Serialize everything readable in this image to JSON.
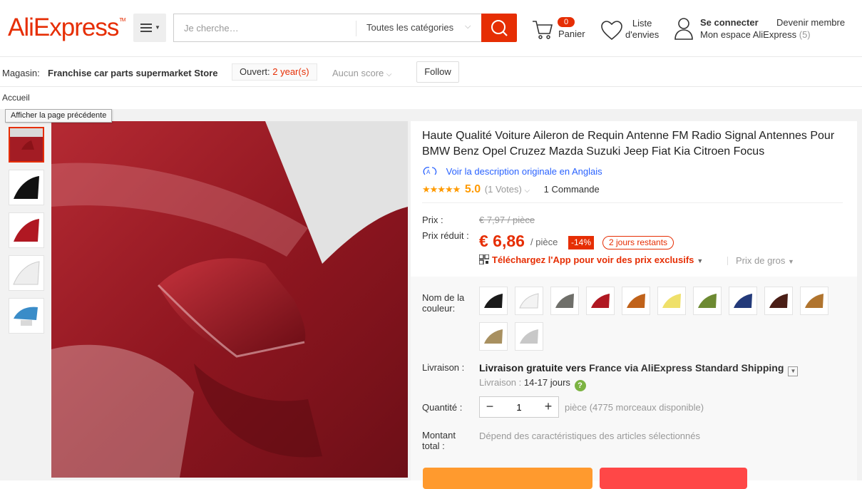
{
  "header": {
    "logo": "AliExpress",
    "logo_tm": "TM",
    "search_placeholder": "Je cherche…",
    "category_select": "Toutes les catégories",
    "cart_count": "0",
    "cart_label": "Panier",
    "wishlist_label_1": "Liste",
    "wishlist_label_2": "d'envies",
    "signin": "Se connecter",
    "join": "Devenir membre",
    "my_account": "Mon espace AliExpress",
    "my_account_count": "(5)"
  },
  "store": {
    "label": "Magasin:",
    "name": "Franchise car parts supermarket Store",
    "open_label": "Ouvert:",
    "open_value": "2 year(s)",
    "score": "Aucun score",
    "follow": "Follow"
  },
  "breadcrumb": "Accueil",
  "tooltip": "Afficher la page précédente",
  "product": {
    "title": "Haute Qualité Voiture Aileron de Requin Antenne FM Radio Signal Antennes Pour BMW Benz Opel Cruzez Mazda Suzuki Jeep Fiat Kia Citroen Focus",
    "translate_link": "Voir la description originale en Anglais",
    "stars": "★★★★★",
    "score": "5.0",
    "votes": "(1 Votes)",
    "orders": "1 Commande",
    "price_label": "Prix :",
    "old_price": "€ 7,97 / pièce",
    "discount_label": "Prix réduit :",
    "price": "€ 6,86",
    "per_unit": "/ pièce",
    "discount": "-14%",
    "remaining": "2 jours restants",
    "app_promo": "Téléchargez l'App pour voir des prix exclusifs",
    "wholesale": "Prix de gros",
    "color_label_1": "Nom de la",
    "color_label_2": "couleur:",
    "delivery_label": "Livraison :",
    "delivery_main": "Livraison gratuite vers",
    "delivery_dest": "France via AliExpress Standard Shipping",
    "delivery_time_label": "Livraison :",
    "delivery_time": "14-17 jours",
    "qty_label": "Quantité :",
    "qty_value": "1",
    "qty_avail": "pièce (4775 morceaux disponible)",
    "total_label_1": "Montant",
    "total_label_2": "total :",
    "total_value": "Dépend des caractéristiques des articles sélectionnés"
  },
  "colors": {
    "brand": "#e62e04",
    "swatches": [
      "#1a1a1a",
      "#f3f3f3",
      "#6f6f6a",
      "#b01822",
      "#c0621a",
      "#efe06a",
      "#6d8a32",
      "#233a7a",
      "#4a1e16",
      "#b0742e",
      "#a89060",
      "#c8c8c8"
    ]
  }
}
